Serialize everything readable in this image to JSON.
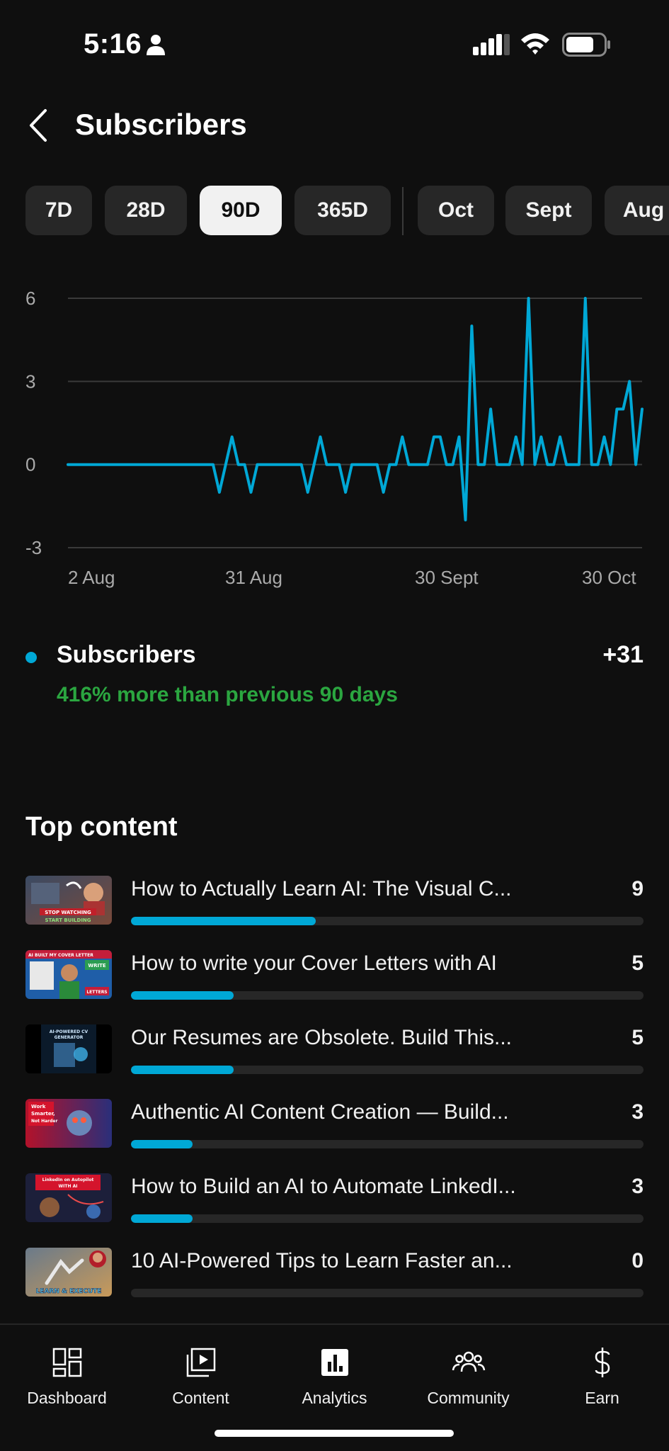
{
  "status_bar": {
    "time": "5:16"
  },
  "header": {
    "title": "Subscribers"
  },
  "periods": [
    "7D",
    "28D",
    "90D",
    "365D",
    "Oct",
    "Sept",
    "Aug"
  ],
  "selected_period": "90D",
  "chart_data": {
    "type": "line",
    "y_ticks": [
      "6",
      "3",
      "0",
      "-3"
    ],
    "x_tick_labels": [
      "2 Aug",
      "31 Aug",
      "30 Sept",
      "30 Oct"
    ],
    "ylim": [
      -3,
      6
    ],
    "grid": true,
    "series": [
      {
        "color": "#00a8d6",
        "values": [
          0,
          0,
          0,
          0,
          0,
          0,
          0,
          0,
          0,
          0,
          0,
          0,
          0,
          0,
          0,
          0,
          0,
          0,
          0,
          0,
          0,
          0,
          0,
          0,
          -1,
          0,
          1,
          0,
          0,
          -1,
          0,
          0,
          0,
          0,
          0,
          0,
          0,
          0,
          -1,
          0,
          1,
          0,
          0,
          0,
          -1,
          0,
          0,
          0,
          0,
          0,
          -1,
          0,
          0,
          1,
          0,
          0,
          0,
          0,
          1,
          1,
          0,
          0,
          1,
          -2,
          5,
          0,
          0,
          2,
          0,
          0,
          0,
          1,
          0,
          6,
          0,
          1,
          0,
          0,
          1,
          0,
          0,
          0,
          6,
          0,
          0,
          1,
          0,
          2,
          2,
          3,
          0,
          2
        ]
      }
    ]
  },
  "summary": {
    "label": "Subscribers",
    "value": "+31",
    "change_text": "416% more than previous 90 days",
    "series_color": "#00a8d6",
    "change_color": "#2ba640"
  },
  "top_content": {
    "title": "Top content",
    "items": [
      {
        "title": "How to Actually Learn AI: The Visual C...",
        "count": "9",
        "progress": 0.36
      },
      {
        "title": "How to write your Cover Letters with AI",
        "count": "5",
        "progress": 0.2
      },
      {
        "title": "Our Resumes are Obsolete. Build This...",
        "count": "5",
        "progress": 0.2
      },
      {
        "title": "Authentic AI Content Creation — Build...",
        "count": "3",
        "progress": 0.12
      },
      {
        "title": "How to Build an AI to Automate LinkedI...",
        "count": "3",
        "progress": 0.12
      },
      {
        "title": "10 AI-Powered Tips to Learn Faster an...",
        "count": "0",
        "progress": 0
      }
    ]
  },
  "thumbnails": [
    {
      "text_lines": [
        "STOP WATCHING",
        "START BUILDING"
      ]
    },
    {
      "text_lines": [
        "AI BUILT MY COVER LETTER",
        "WRITE",
        "LETTERS"
      ]
    },
    {
      "text_lines": [
        "AI-POWERED CV",
        "GENERATOR"
      ]
    },
    {
      "text_lines": [
        "Work",
        "Smarter,",
        "Not Harder"
      ]
    },
    {
      "text_lines": [
        "LinkedIn on Autopilot",
        "WITH AI"
      ]
    },
    {
      "text_lines": [
        "LEARN & EXECUTE"
      ]
    }
  ],
  "bottom_nav": [
    {
      "label": "Dashboard",
      "icon": "dashboard-icon"
    },
    {
      "label": "Content",
      "icon": "content-icon"
    },
    {
      "label": "Analytics",
      "icon": "analytics-icon"
    },
    {
      "label": "Community",
      "icon": "community-icon"
    },
    {
      "label": "Earn",
      "icon": "earn-icon"
    }
  ]
}
